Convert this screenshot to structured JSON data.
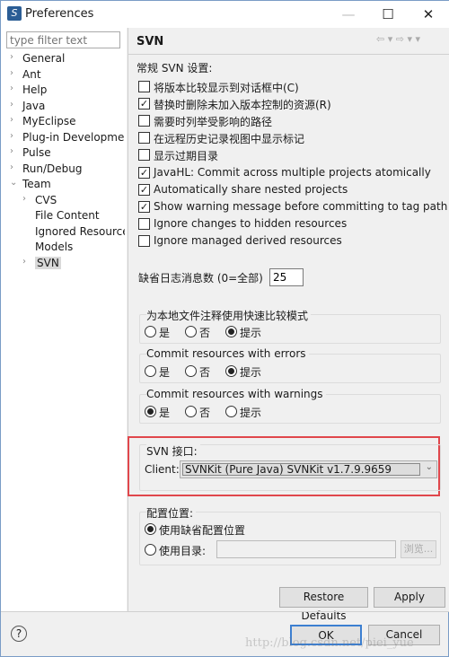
{
  "window": {
    "title": "Preferences",
    "minimize": "—",
    "maximize": "☐",
    "close": "✕"
  },
  "filter": {
    "placeholder": "type filter text"
  },
  "tree": [
    {
      "label": "General",
      "arrow": "›",
      "level": 0
    },
    {
      "label": "Ant",
      "arrow": "›",
      "level": 0
    },
    {
      "label": "Help",
      "arrow": "›",
      "level": 0
    },
    {
      "label": "Java",
      "arrow": "›",
      "level": 0
    },
    {
      "label": "MyEclipse",
      "arrow": "›",
      "level": 0
    },
    {
      "label": "Plug-in Development",
      "arrow": "›",
      "level": 0
    },
    {
      "label": "Pulse",
      "arrow": "›",
      "level": 0
    },
    {
      "label": "Run/Debug",
      "arrow": "›",
      "level": 0
    },
    {
      "label": "Team",
      "arrow": "⌄",
      "level": 0
    },
    {
      "label": "CVS",
      "arrow": "›",
      "level": 1
    },
    {
      "label": "File Content",
      "arrow": "",
      "level": 1
    },
    {
      "label": "Ignored Resources",
      "arrow": "",
      "level": 1
    },
    {
      "label": "Models",
      "arrow": "",
      "level": 1
    },
    {
      "label": "SVN",
      "arrow": "›",
      "level": 1,
      "selected": true
    }
  ],
  "page": {
    "title": "SVN",
    "nav": "⇦ ▾ ⇨ ▾ ▾",
    "general_label": "常规 SVN 设置:"
  },
  "checkboxes": [
    {
      "label": "将版本比较显示到对话框中(C)",
      "checked": false
    },
    {
      "label": "替换时删除未加入版本控制的资源(R)",
      "checked": true
    },
    {
      "label": "需要时列举受影响的路径",
      "checked": false
    },
    {
      "label": "在远程历史记录视图中显示标记",
      "checked": false
    },
    {
      "label": "显示过期目录",
      "checked": false
    },
    {
      "label": "JavaHL: Commit across multiple projects atomically",
      "checked": true
    },
    {
      "label": "Automatically share nested projects",
      "checked": true
    },
    {
      "label": "Show warning message before committing to tag path",
      "checked": true
    },
    {
      "label": "Ignore changes to hidden resources",
      "checked": false
    },
    {
      "label": "Ignore managed derived resources",
      "checked": false
    }
  ],
  "log": {
    "label": "缺省日志消息数 (0=全部)",
    "value": "25"
  },
  "groups": [
    {
      "label": "为本地文件注释使用快速比较模式",
      "options": [
        "是",
        "否",
        "提示"
      ],
      "selected": 2
    },
    {
      "label": "Commit resources with errors",
      "options": [
        "是",
        "否",
        "提示"
      ],
      "selected": 2
    },
    {
      "label": "Commit resources with warnings",
      "options": [
        "是",
        "否",
        "提示"
      ],
      "selected": 0
    }
  ],
  "svn_interface": {
    "label": "SVN 接口:",
    "client_label": "Client:",
    "client_value": "SVNKit (Pure Java) SVNKit v1.7.9.9659",
    "highlight_color": "#e0474c"
  },
  "config": {
    "label": "配置位置:",
    "default_option": "使用缺省配置位置",
    "dir_option": "使用目录:",
    "selected": 0,
    "dir_value": "",
    "browse": "浏览..."
  },
  "buttons": {
    "restore": "Restore Defaults",
    "apply": "Apply",
    "ok": "OK",
    "cancel": "Cancel",
    "help": "?"
  },
  "watermark": "http://blog.csdn.net/piei_yue"
}
